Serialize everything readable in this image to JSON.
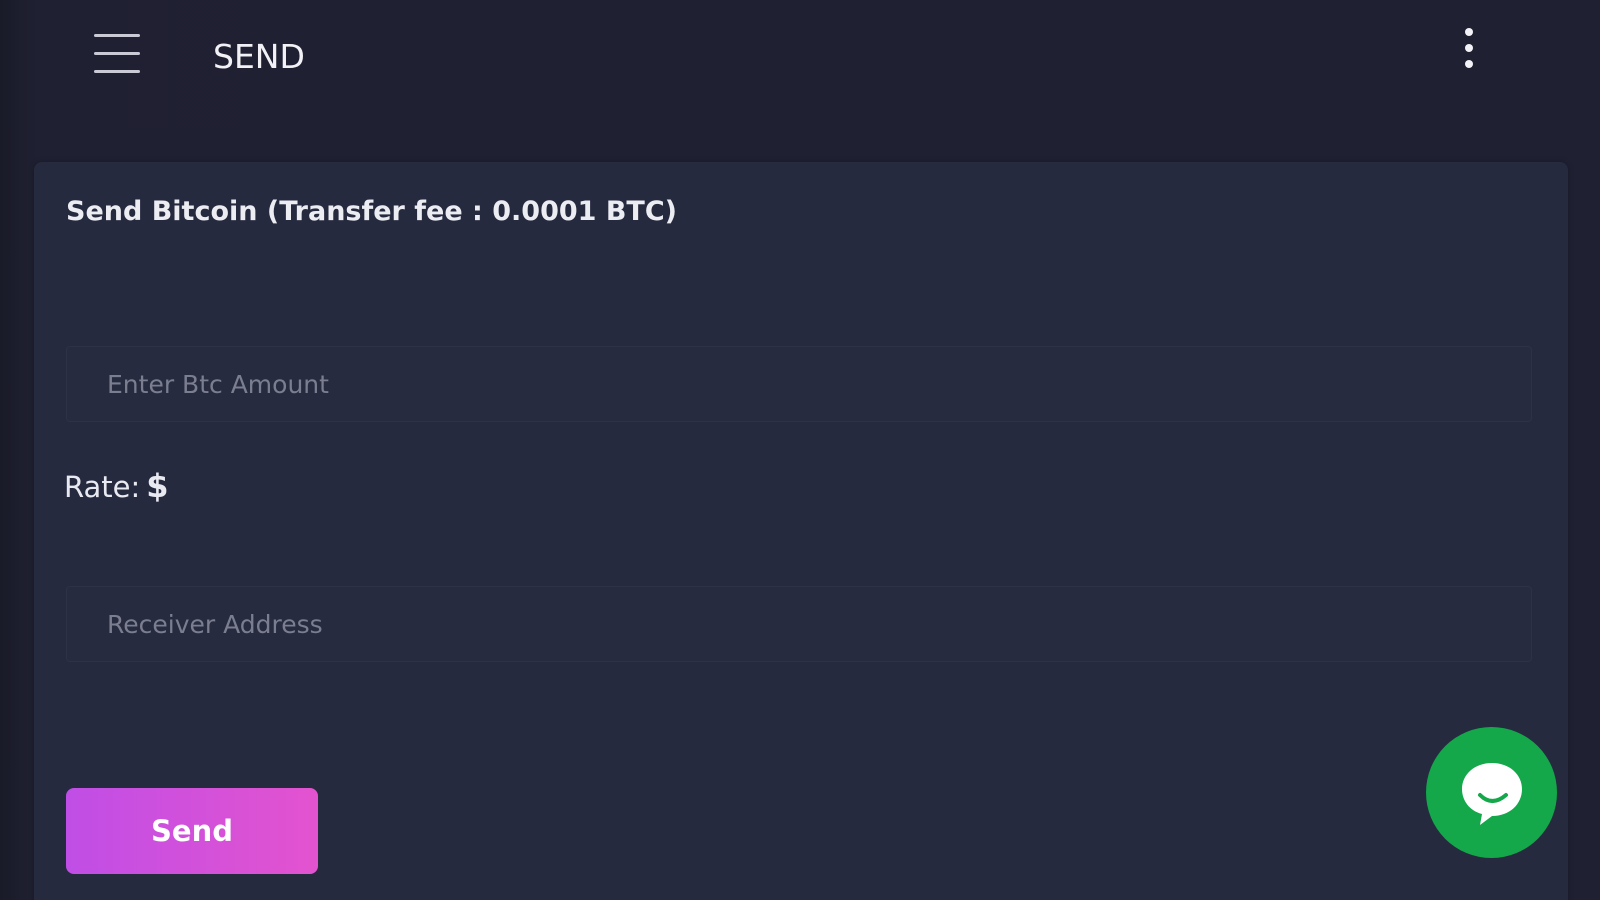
{
  "header": {
    "title": "SEND"
  },
  "card": {
    "heading": "Send Bitcoin (Transfer fee : 0.0001 BTC)",
    "amount_field": {
      "placeholder": "Enter Btc Amount",
      "value": ""
    },
    "rate": {
      "label": "Rate:",
      "value": "$"
    },
    "address_field": {
      "placeholder": "Receiver Address",
      "value": ""
    },
    "send_label": "Send"
  },
  "colors": {
    "background": "#1f2032",
    "card": "#262a3f",
    "accent_gradient_start": "#c04ee6",
    "accent_gradient_end": "#e353cf",
    "chat_button": "#14a84b"
  },
  "icons": {
    "menu": "hamburger-menu-icon",
    "more": "vertical-dots-icon",
    "chat": "chat-bubble-icon"
  }
}
